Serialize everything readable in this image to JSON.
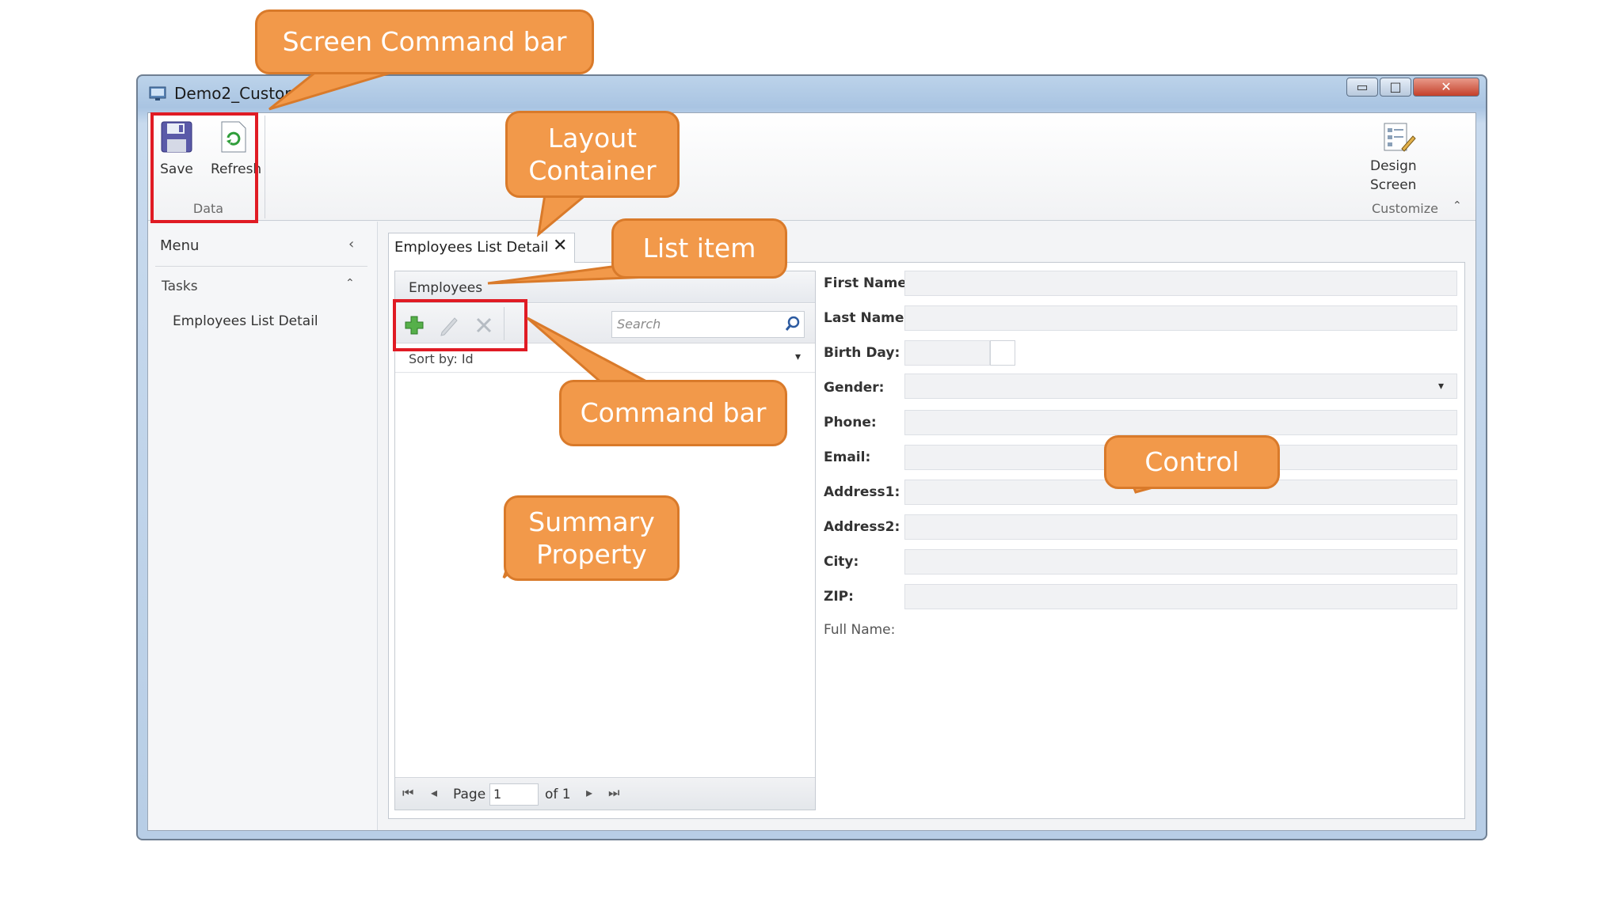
{
  "window": {
    "title": "Demo2_Customi",
    "min_glyph": "▭",
    "max_glyph": "□",
    "close_glyph": "✕"
  },
  "ribbon": {
    "save_label": "Save",
    "refresh_label": "Refresh",
    "data_group_label": "Data",
    "design_label_line1": "Design",
    "design_label_line2": "Screen",
    "customize_group_label": "Customize",
    "customize_chevron": "⌃"
  },
  "menu": {
    "title": "Menu",
    "collapse_glyph": "‹",
    "tasks_label": "Tasks",
    "tasks_chevron": "⌃",
    "items": [
      {
        "label": "Employees List Detail"
      }
    ]
  },
  "tab": {
    "label": "Employees List Detail",
    "close_glyph": "✕"
  },
  "list": {
    "header": "Employees",
    "search_placeholder": "Search",
    "sort_label": "Sort by: Id",
    "sort_drop_glyph": "▾",
    "pager": {
      "first_glyph": "⏮",
      "prev_glyph": "◂",
      "page_label": "Page",
      "page_value": "1",
      "of_label": "of 1",
      "next_glyph": "▸",
      "last_glyph": "⏭"
    }
  },
  "form": {
    "fields": [
      {
        "label": "First Name:"
      },
      {
        "label": "Last Name:"
      },
      {
        "label": "Birth Day:"
      },
      {
        "label": "Gender:"
      },
      {
        "label": "Phone:"
      },
      {
        "label": "Email:"
      },
      {
        "label": "Address1:"
      },
      {
        "label": "Address2:"
      },
      {
        "label": "City:"
      },
      {
        "label": "ZIP:"
      },
      {
        "label": "Full Name:"
      }
    ],
    "dropdown_glyph": "▾"
  },
  "callouts": {
    "screen_command_bar": "Screen Command bar",
    "layout_container_line1": "Layout",
    "layout_container_line2": "Container",
    "list_item": "List item",
    "command_bar": "Command bar",
    "summary_property_line1": "Summary",
    "summary_property_line2": "Property",
    "control": "Control"
  },
  "colors": {
    "callout_fill": "#f2994a",
    "callout_border": "#d97a2a",
    "highlight_box": "#e01b24",
    "window_frame": "#b8cee6"
  },
  "icons": {
    "save": "floppy-disk-icon",
    "refresh": "refresh-document-icon",
    "design_screen": "design-screen-icon",
    "add": "plus-icon",
    "edit": "pencil-icon",
    "delete": "x-icon",
    "search": "magnifier-icon"
  }
}
